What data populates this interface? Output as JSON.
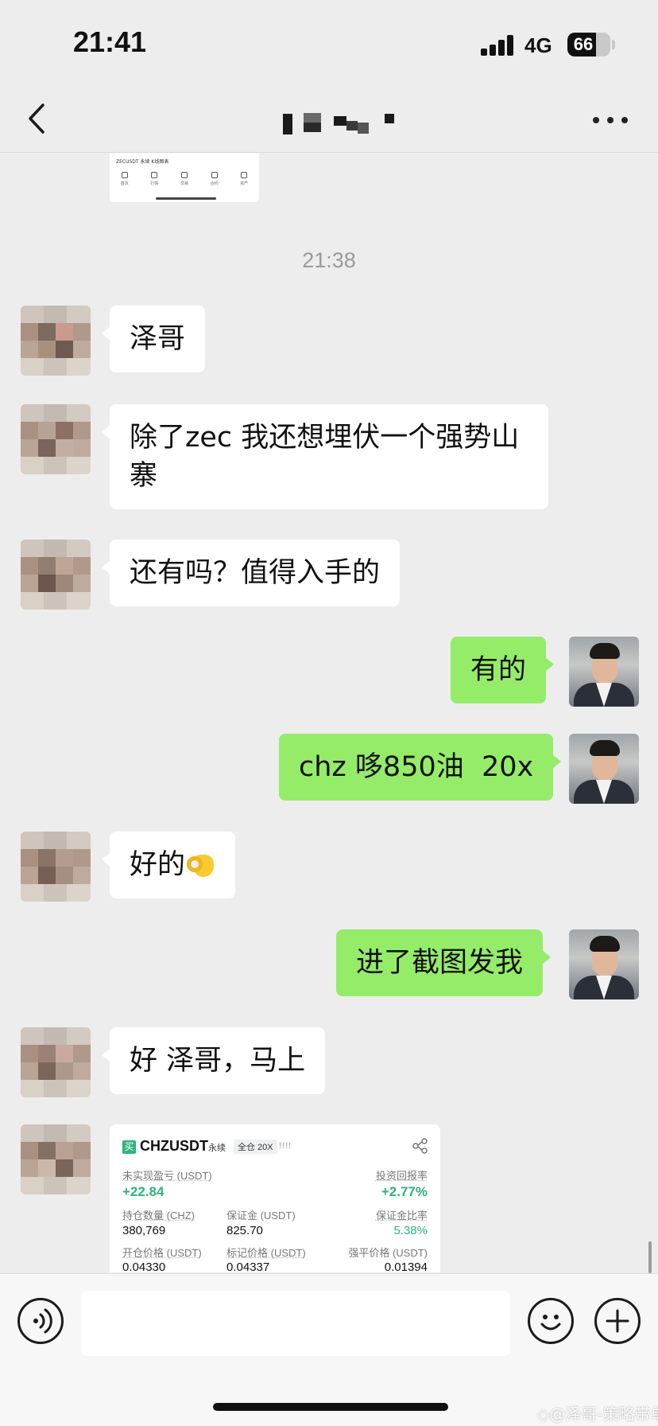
{
  "status_bar": {
    "time": "21:41",
    "network": "4G",
    "battery": "66"
  },
  "top_card": {
    "title": "ZECUSDT 永续 K线图表",
    "tabs": [
      "首页",
      "行情",
      "交易",
      "合约",
      "资产"
    ]
  },
  "chat": {
    "timestamp": "21:38",
    "messages": [
      {
        "from": "other",
        "text": "泽哥"
      },
      {
        "from": "other",
        "text_line1": "除了zec 我还想埋伏一个强势山",
        "text_line2": "寨"
      },
      {
        "from": "other",
        "text": "还有吗？值得入手的"
      },
      {
        "from": "me",
        "text": "有的"
      },
      {
        "from": "me",
        "text": "chz 哆850油  20x"
      },
      {
        "from": "other",
        "text": "好的",
        "emoji": "ok-hand-emoji"
      },
      {
        "from": "me",
        "text": "进了截图发我"
      },
      {
        "from": "other",
        "text": "好 泽哥，马上"
      }
    ]
  },
  "trade_card": {
    "badge": "买",
    "symbol": "CHZUSDT",
    "tag_perp": "永续",
    "tag_margin": "全仓 20X",
    "bars": "!!!!",
    "unrealized_pnl_label": "未实现盈亏 (USDT)",
    "unrealized_pnl_value": "+22.84",
    "roi_label": "投资回报率",
    "roi_value": "+2.77%",
    "position_size_label": "持仓数量 (CHZ)",
    "position_size_value": "380,769",
    "margin_label": "保证金 (USDT)",
    "margin_value": "825.70",
    "margin_ratio_label": "保证金比率",
    "margin_ratio_value": "5.38%",
    "entry_price_label": "开仓价格 (USDT)",
    "entry_price_value": "0.04330",
    "mark_price_label": "标记价格 (USDT)",
    "mark_price_value": "0.04337",
    "liq_price_label": "强平价格 (USDT)",
    "liq_price_value": "0.01394"
  },
  "input_bar": {
    "placeholder": ""
  },
  "watermark": "◇@泽哥-策略带单",
  "colors": {
    "background": "#ededed",
    "incoming_bubble": "#ffffff",
    "outgoing_bubble": "#95ec69",
    "profit_green": "#2fb37c"
  }
}
